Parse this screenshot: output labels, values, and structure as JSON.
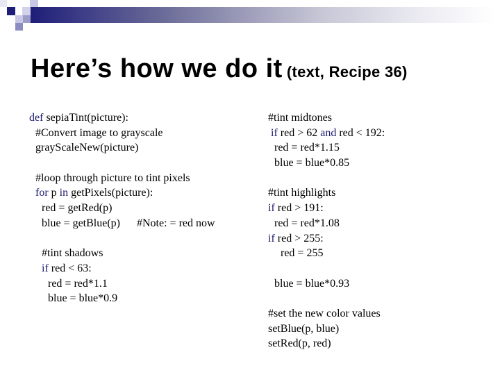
{
  "slide": {
    "title": "Here’s how we do it",
    "subtitle": "(text, Recipe 36)",
    "colors": {
      "accent_dark": "#1e1e78",
      "accent_medium": "#8c8cc0",
      "accent_light": "#c8c8e6",
      "keyword": "#1a1a6e",
      "text": "#000000"
    }
  },
  "code": {
    "left_column": [
      {
        "indent": 0,
        "segments": [
          {
            "kw": "def"
          },
          {
            "t": " sepiaTint(picture):"
          }
        ]
      },
      {
        "indent": 1,
        "segments": [
          {
            "t": "#Convert image to grayscale"
          }
        ]
      },
      {
        "indent": 1,
        "segments": [
          {
            "t": "grayScaleNew(picture)"
          }
        ]
      },
      {
        "indent": 0,
        "segments": []
      },
      {
        "indent": 1,
        "segments": [
          {
            "t": "#loop through picture to tint pixels"
          }
        ]
      },
      {
        "indent": 1,
        "segments": [
          {
            "kw": "for"
          },
          {
            "t": " p "
          },
          {
            "kw": "in"
          },
          {
            "t": " getPixels(picture):"
          }
        ]
      },
      {
        "indent": 2,
        "segments": [
          {
            "t": "red = getRed(p)"
          }
        ]
      },
      {
        "indent": 2,
        "segments": [
          {
            "t": "blue = getBlue(p)      #Note: = red now"
          }
        ]
      },
      {
        "indent": 0,
        "segments": []
      },
      {
        "indent": 2,
        "segments": [
          {
            "t": "#tint shadows"
          }
        ]
      },
      {
        "indent": 2,
        "segments": [
          {
            "kw": "if"
          },
          {
            "t": " red < 63:"
          }
        ]
      },
      {
        "indent": 3,
        "segments": [
          {
            "t": "red = red*1.1"
          }
        ]
      },
      {
        "indent": 3,
        "segments": [
          {
            "t": "blue = blue*0.9"
          }
        ]
      }
    ],
    "right_column": [
      {
        "indent": 0,
        "segments": [
          {
            "t": "#tint midtones"
          }
        ]
      },
      {
        "indent": 0,
        "segments": [
          {
            "t": " "
          },
          {
            "kw": "if"
          },
          {
            "t": " red > 62 "
          },
          {
            "kw": "and"
          },
          {
            "t": " red < 192:"
          }
        ]
      },
      {
        "indent": 1,
        "segments": [
          {
            "t": "red = red*1.15"
          }
        ]
      },
      {
        "indent": 1,
        "segments": [
          {
            "t": "blue = blue*0.85"
          }
        ]
      },
      {
        "indent": 0,
        "segments": []
      },
      {
        "indent": 0,
        "segments": [
          {
            "t": "#tint highlights"
          }
        ]
      },
      {
        "indent": 0,
        "segments": [
          {
            "kw": "if"
          },
          {
            "t": " red > 191:"
          }
        ]
      },
      {
        "indent": 1,
        "segments": [
          {
            "t": "red = red*1.08"
          }
        ]
      },
      {
        "indent": 0,
        "segments": [
          {
            "kw": "if"
          },
          {
            "t": " red > 255:"
          }
        ]
      },
      {
        "indent": 2,
        "segments": [
          {
            "t": "red = 255"
          }
        ]
      },
      {
        "indent": 0,
        "segments": []
      },
      {
        "indent": 1,
        "segments": [
          {
            "t": "blue = blue*0.93"
          }
        ]
      },
      {
        "indent": 0,
        "segments": []
      },
      {
        "indent": 0,
        "segments": [
          {
            "t": "#set the new color values"
          }
        ]
      },
      {
        "indent": 0,
        "segments": [
          {
            "t": "setBlue(p, blue)"
          }
        ]
      },
      {
        "indent": 0,
        "segments": [
          {
            "t": "setRed(p, red)"
          }
        ]
      }
    ]
  }
}
